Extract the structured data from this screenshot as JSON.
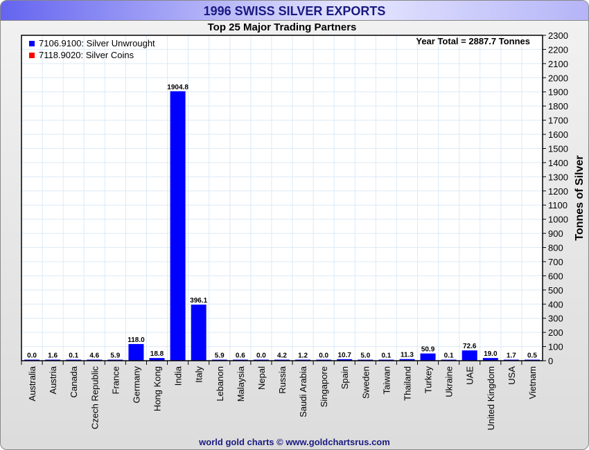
{
  "header": {
    "title": "1996 SWISS SILVER EXPORTS",
    "footer": "world gold charts © www.goldchartsrus.com"
  },
  "chart_data": {
    "type": "bar",
    "title": "1996 SWISS SILVER EXPORTS",
    "subtitle": "Top 25 Major Trading Partners",
    "annotation": "Year Total = 2887.7 Tonnes",
    "xlabel": "",
    "ylabel": "Tonnes of Silver",
    "ylim": [
      0,
      2300
    ],
    "ytick_step": 100,
    "grid": true,
    "legend_placement": "top-left",
    "legend": [
      {
        "label": "7106.9100: Silver Unwrought",
        "color": "#0000ff"
      },
      {
        "label": "7118.9020: Silver Coins",
        "color": "#ff0000"
      }
    ],
    "categories": [
      "Australia",
      "Austria",
      "Canada",
      "Czech Republic",
      "France",
      "Germany",
      "Hong Kong",
      "India",
      "Italy",
      "Lebanon",
      "Malaysia",
      "Nepal",
      "Russia",
      "Saudi Arabia",
      "Singapore",
      "Spain",
      "Sweden",
      "Taiwan",
      "Thailand",
      "Turkey",
      "Ukraine",
      "UAE",
      "United Kingdom",
      "USA",
      "Vietnam"
    ],
    "series": [
      {
        "name": "7106.9100: Silver Unwrought",
        "color": "#0000ff",
        "values": [
          0.0,
          1.6,
          0.1,
          4.6,
          5.9,
          118.0,
          18.8,
          1904.8,
          396.1,
          5.9,
          0.6,
          0.0,
          4.2,
          1.2,
          0.0,
          10.7,
          5.0,
          0.1,
          11.3,
          50.9,
          0.1,
          72.6,
          19.0,
          1.7,
          0.5
        ]
      }
    ],
    "data_labels": [
      "0.0",
      "1.6",
      "0.1",
      "4.6",
      "5.9",
      "118.0",
      "18.8",
      "1904.8",
      "396.1",
      "5.9",
      "0.6",
      "0.0",
      "4.2",
      "1.2",
      "0.0",
      "10.7",
      "5.0",
      "0.1",
      "11.3",
      "50.9",
      "0.1",
      "72.6",
      "19.0",
      "1.7",
      "0.5"
    ]
  }
}
